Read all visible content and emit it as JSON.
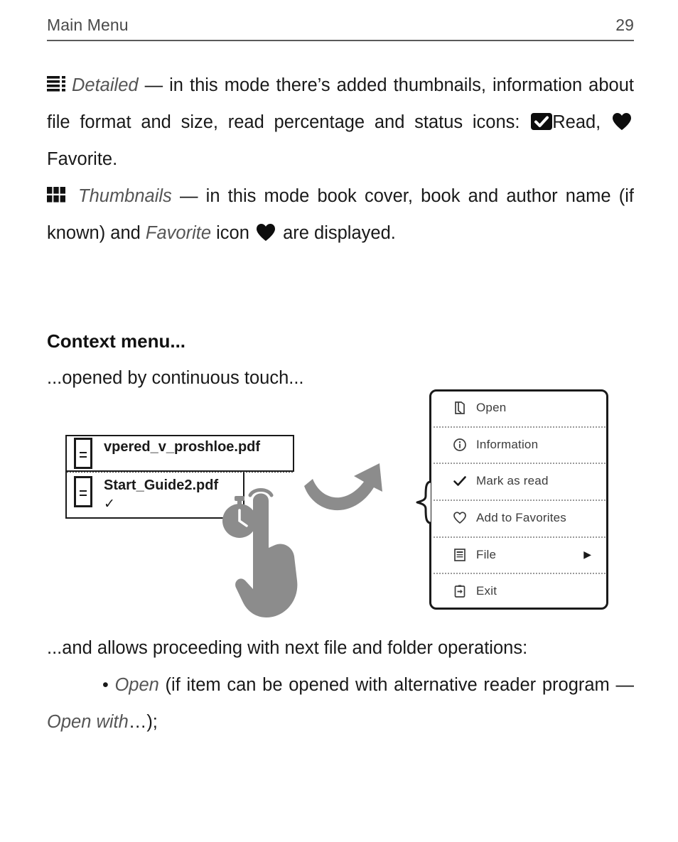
{
  "header": {
    "title": "Main Menu",
    "page_number": "29"
  },
  "paragraphs": {
    "detailed": {
      "icon": "detailed-list-icon",
      "term": "Detailed",
      "dash": " — ",
      "text_before_read": "in this mode there’s added thumbnails, information about file format and size, read percentage and status icons: ",
      "read_icon": "read-checkbox-icon",
      "read_label": "Read, ",
      "favorite_icon": "favorite-heart-icon",
      "favorite_label": " Favorite."
    },
    "thumbnails": {
      "icon": "thumbnails-grid-icon",
      "term": "Thumbnails",
      "dash": " — ",
      "text_before_fav": "in this mode book cover, book and author name (if known) and ",
      "favorite_term": "Favorite",
      "text_mid": " icon ",
      "favorite_icon": "favorite-heart-icon",
      "text_after": " are displayed."
    }
  },
  "section": {
    "heading": "Context menu...",
    "subtitle": "...opened by continuous touch..."
  },
  "figure": {
    "file_list": {
      "items": [
        {
          "icon": "file-pdf-icon",
          "name": "vpered_v_proshloe.pdf",
          "read_check": ""
        },
        {
          "icon": "file-pdf-icon",
          "name": "Start_Guide2.pdf",
          "read_check": "✓"
        }
      ]
    },
    "gesture": {
      "hand_icon": "pointing-hand-icon",
      "timer_icon": "stopwatch-long-press-icon",
      "arrow_icon": "curved-arrow-icon"
    },
    "context_menu": {
      "items": [
        {
          "icon": "open-book-icon",
          "label": "Open",
          "submenu": ""
        },
        {
          "icon": "information-icon",
          "label": "Information",
          "submenu": ""
        },
        {
          "icon": "checkmark-icon",
          "label": "Mark as read",
          "submenu": ""
        },
        {
          "icon": "heart-outline-icon",
          "label": "Add to Favorites",
          "submenu": ""
        },
        {
          "icon": "file-document-icon",
          "label": "File",
          "submenu": "▶"
        },
        {
          "icon": "exit-icon",
          "label": "Exit",
          "submenu": ""
        }
      ]
    }
  },
  "body_after": {
    "text": "...and allows proceeding with next file and folder operations:"
  },
  "bullets": [
    {
      "marker": "•",
      "term": "Open",
      "text_mid": " (if item can be opened with alternative reader program — ",
      "term2": "Open with",
      "text_after": "…);"
    }
  ],
  "colors": {
    "text": "#191919",
    "muted": "#555555",
    "rule": "#5a5a5a",
    "gesture_gray": "#8c8c8c"
  }
}
